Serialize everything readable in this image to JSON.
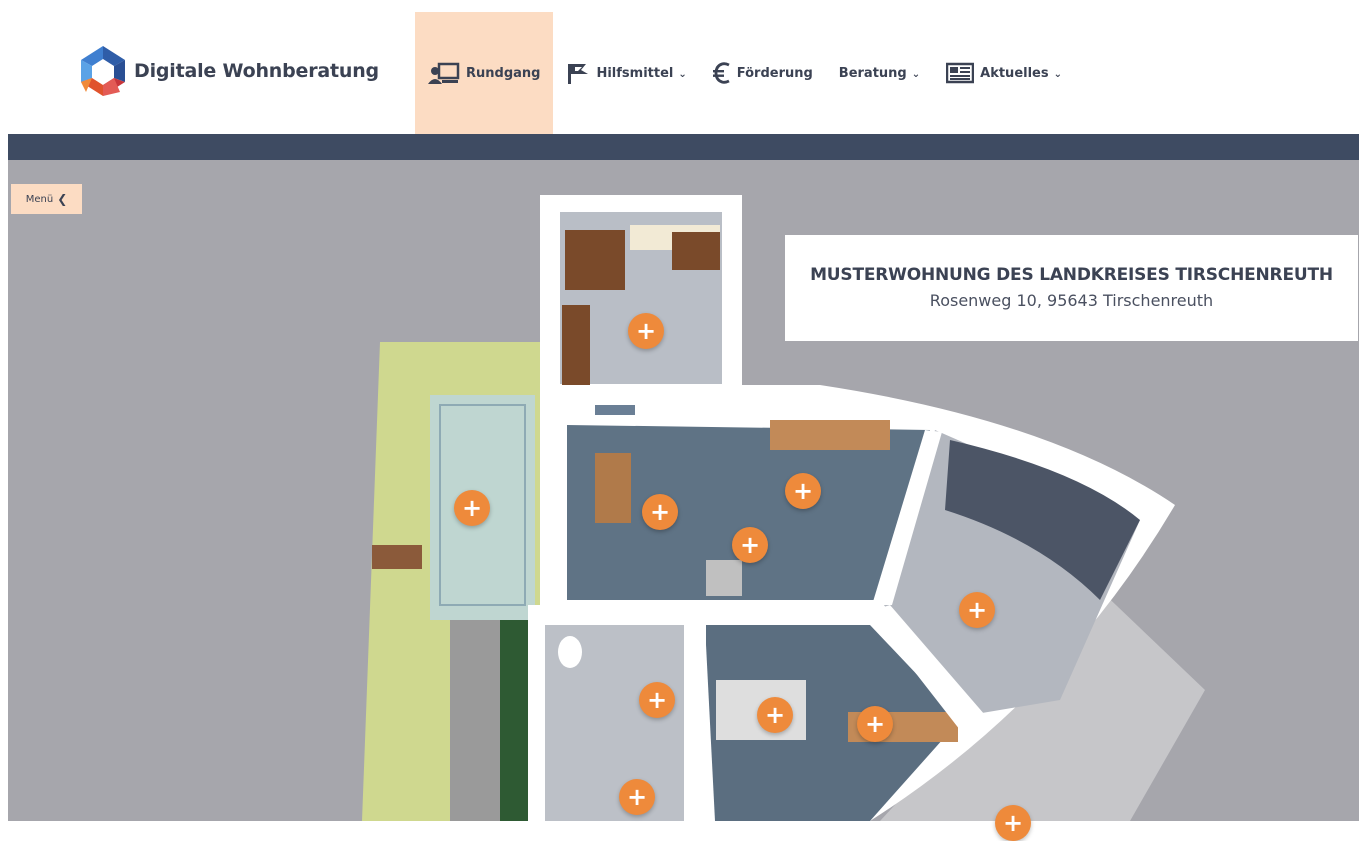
{
  "brand": {
    "name": "Digitale Wohnberatung"
  },
  "nav": {
    "items": [
      {
        "label": "Rundgang",
        "icon": "screen-person-icon",
        "active": true,
        "dropdown": false
      },
      {
        "label": "Hilfsmittel",
        "icon": "flag-icon",
        "active": false,
        "dropdown": true
      },
      {
        "label": "Förderung",
        "icon": "euro-icon",
        "active": false,
        "dropdown": false
      },
      {
        "label": "Beratung",
        "icon": "",
        "active": false,
        "dropdown": true
      },
      {
        "label": "Aktuelles",
        "icon": "newspaper-icon",
        "active": false,
        "dropdown": true
      }
    ],
    "chevron": "⌄"
  },
  "menu": {
    "label": "Menü",
    "chevron": "❮"
  },
  "info": {
    "title": "MUSTERWOHNUNG DES LANDKREISES TIRSCHENREUTH",
    "address": "Rosenweg 10, 95643 Tirschenreuth"
  },
  "hotspot_symbol": "+",
  "colors": {
    "accent": "#ee8a3b",
    "nav_active": "#fcdcc3",
    "bar": "#3e4b62",
    "text": "#3b4253",
    "stage": "#a6a6ac"
  }
}
